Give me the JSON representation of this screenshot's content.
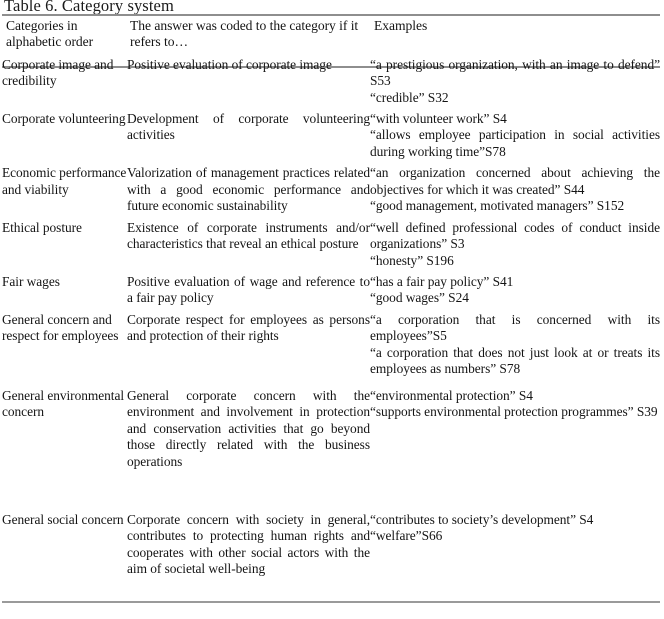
{
  "caption": "Table 6. Category system",
  "table": {
    "headers": [
      "Categories in alphabetic order",
      "The answer was coded to the category if it refers to…",
      "Examples"
    ],
    "rows": [
      {
        "category": "Corporate image and credibility",
        "definition": "Positive evaluation of corporate image",
        "examples": [
          "“a prestigious organization, with an image to defend” S53",
          "“credible” S32"
        ]
      },
      {
        "category": "Corporate volunteering",
        "definition": "Development of corporate volunteering activities",
        "examples": [
          "“with volunteer work” S4",
          "“allows employee participation in social activities during working time”S78"
        ]
      },
      {
        "category": "Economic performance and viability",
        "definition": "Valorization of management practices related with a good economic performance and future economic sustainability",
        "examples": [
          "“an organization concerned about achieving the objectives for which it was created” S44",
          "“good management, motivated managers” S152"
        ]
      },
      {
        "category": "Ethical posture",
        "definition": "Existence of corporate instruments and/or characteristics that reveal an ethical posture",
        "examples": [
          " “well defined professional codes of conduct inside organizations” S3",
          " “honesty” S196"
        ]
      },
      {
        "category": "Fair wages",
        "definition": "Positive evaluation of wage and reference to a fair pay policy",
        "examples": [
          "“has a fair pay policy” S41",
          "“good wages” S24"
        ]
      },
      {
        "category": "General concern and respect for employees",
        "definition": "Corporate respect for employees as persons and protection of their rights",
        "examples": [
          "“a corporation that is concerned with its employees”S5",
          "“a corporation that does not just look at or treats its employees as numbers” S78"
        ]
      },
      {
        "category": "General environmental concern",
        "definition": "General corporate concern with the environment and involvement in protection and conservation activities that go beyond those directly related with the business operations",
        "examples": [
          "“environmental protection” S4",
          "“supports environmental protection programmes” S39"
        ]
      },
      {
        "category": "General social concern",
        "definition": "Corporate concern with society in general, contributes to protecting human rights and cooperates with other social actors with the aim of societal well-being",
        "examples": [
          "“contributes to society’s development” S4",
          "“welfare”S66"
        ]
      }
    ]
  }
}
